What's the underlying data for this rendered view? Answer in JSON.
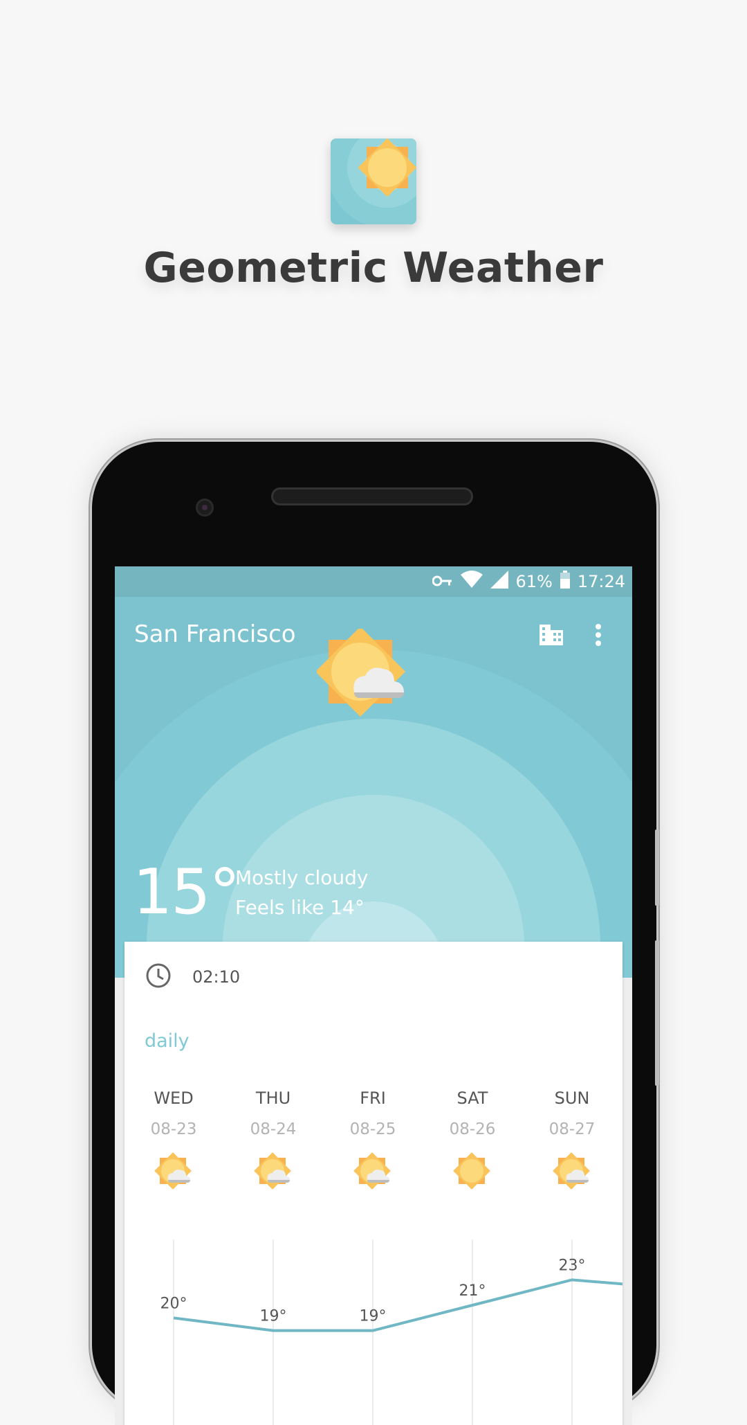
{
  "promo": {
    "app_name": "Geometric Weather",
    "app_icon": "sun-app-icon"
  },
  "status_bar": {
    "icons": [
      "vpn-key-icon",
      "wifi-icon",
      "signal-icon",
      "battery-icon"
    ],
    "battery": "61%",
    "time": "17:24"
  },
  "header": {
    "city": "San Francisco",
    "actions": [
      "city-building-icon",
      "more-vert-icon"
    ],
    "temperature": "15°",
    "condition": "Mostly cloudy",
    "feels_like": "Feels like 14°",
    "weather_icon": "partly-cloudy-sun-icon",
    "background_color": "#7dc3cf"
  },
  "card": {
    "refresh_time": "02:10",
    "section_title": "daily",
    "days": [
      {
        "name": "WED",
        "date": "08-23",
        "icon": "partly-cloudy-icon",
        "temp": "20°"
      },
      {
        "name": "THU",
        "date": "08-24",
        "icon": "partly-cloudy-icon",
        "temp": "19°"
      },
      {
        "name": "FRI",
        "date": "08-25",
        "icon": "partly-cloudy-icon",
        "temp": "19°"
      },
      {
        "name": "SAT",
        "date": "08-26",
        "icon": "sunny-icon",
        "temp": "21°"
      },
      {
        "name": "SUN",
        "date": "08-27",
        "icon": "partly-cloudy-icon",
        "temp": "23°"
      }
    ],
    "accent_color": "#7fcad4",
    "line_color": "#6fb7c4"
  },
  "chart_data": {
    "type": "line",
    "categories": [
      "WED",
      "THU",
      "FRI",
      "SAT",
      "SUN"
    ],
    "values": [
      20,
      19,
      19,
      21,
      23
    ],
    "labels": [
      "20°",
      "19°",
      "19°",
      "21°",
      "23°"
    ]
  }
}
